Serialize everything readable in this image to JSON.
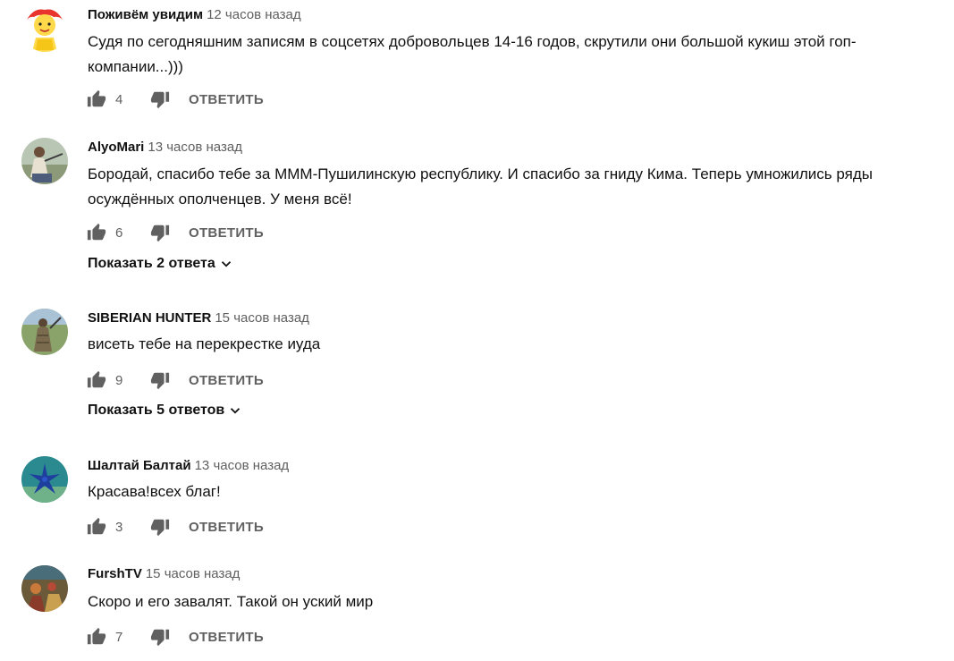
{
  "comments": [
    {
      "author": "Поживём увидим",
      "time": "12 часов назад",
      "text": "Судя по сегодняшним записям в соцсетях добровольцев 14-16 годов, скрутили они большой кукиш этой гоп-компании...)))",
      "likes": "4",
      "reply_label": "ОТВЕТИТЬ",
      "avatar_icon": "cartoon-child-avatar"
    },
    {
      "author": "AlyoMari",
      "time": "13 часов назад",
      "text": "Бородай, спасибо тебе за МММ-Пушилинскую республику. И спасибо за гниду Кима. Теперь умножились ряды осуждённых ополченцев. У меня всё!",
      "likes": "6",
      "reply_label": "ОТВЕТИТЬ",
      "show_replies": "Показать 2 ответа",
      "avatar_icon": "person-photo-avatar"
    },
    {
      "author": "SIBERIAN HUNTER",
      "time": "15 часов назад",
      "text": "висеть тебе на перекрестке иуда",
      "likes": "9",
      "reply_label": "ОТВЕТИТЬ",
      "show_replies": "Показать 5 ответов",
      "avatar_icon": "hunter-photo-avatar"
    },
    {
      "author": "Шалтай Балтай",
      "time": "13 часов назад",
      "text": "Красава!всех благ!",
      "likes": "3",
      "reply_label": "ОТВЕТИТЬ",
      "avatar_icon": "starfish-photo-avatar"
    },
    {
      "author": "FurshTV",
      "time": "15 часов назад",
      "text": "Скоро и его завалят. Такой он уский мир",
      "likes": "7",
      "reply_label": "ОТВЕТИТЬ",
      "avatar_icon": "painting-avatar"
    }
  ],
  "colors": {
    "text": "#111111",
    "muted": "#606060",
    "icon": "#606060"
  }
}
